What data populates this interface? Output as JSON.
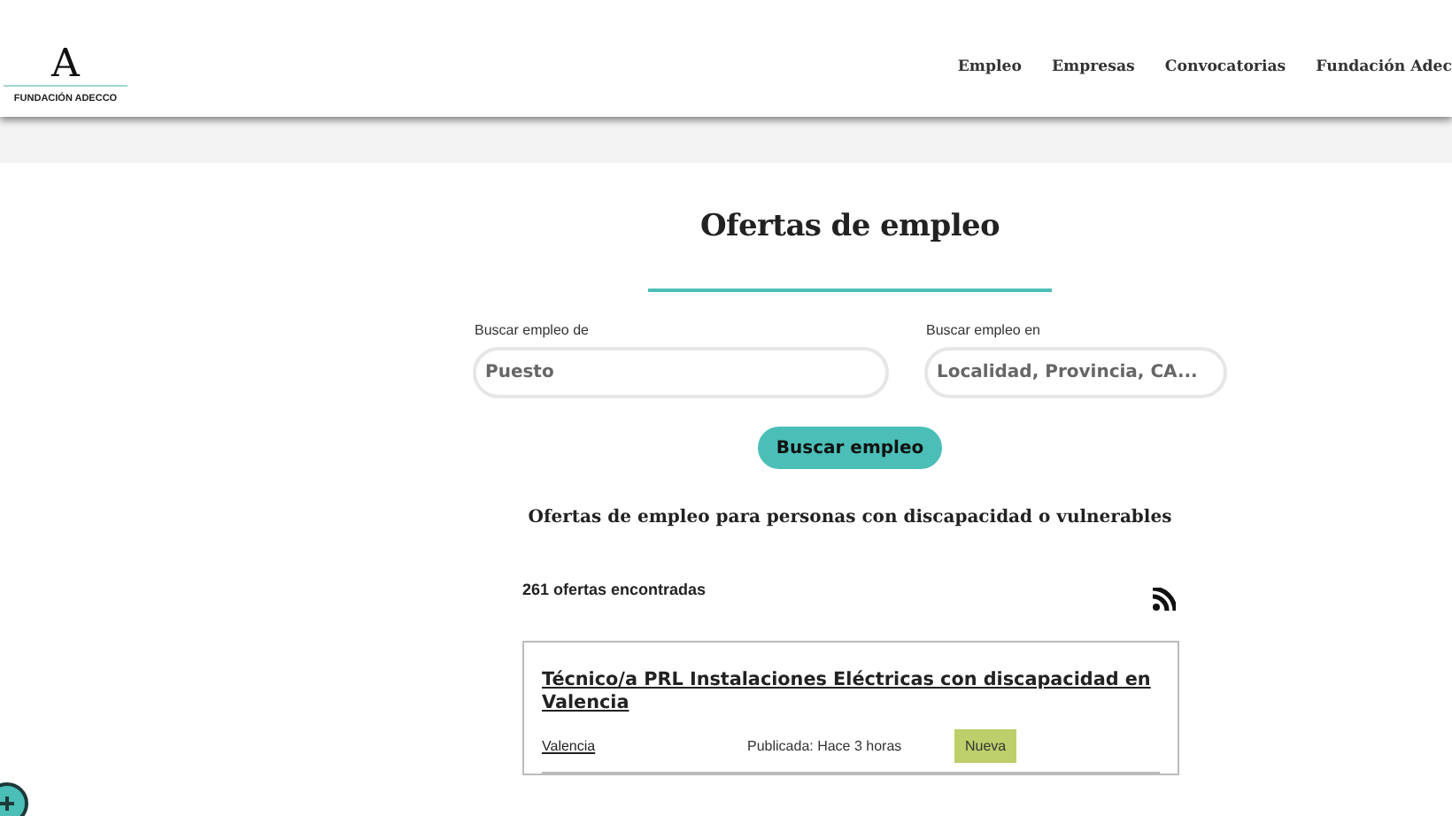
{
  "header": {
    "logo_text": "FUNDACIÓN ADECCO",
    "logo_letter": "A",
    "nav": [
      {
        "label": "Empleo"
      },
      {
        "label": "Empresas"
      },
      {
        "label": "Convocatorias"
      },
      {
        "label": "Fundación Adec"
      }
    ]
  },
  "search": {
    "title": "Ofertas de empleo",
    "fields": [
      {
        "label": "Buscar empleo de",
        "placeholder": "Puesto"
      },
      {
        "label": "Buscar empleo en",
        "placeholder": "Localidad, Provincia, CA..."
      }
    ],
    "button": "Buscar empleo",
    "subtitle": "Ofertas de empleo para personas con discapacidad o vulnerables"
  },
  "results": {
    "count": "261 ofertas encontradas",
    "jobs": [
      {
        "title": "Técnico/a PRL Instalaciones Eléctricas con discapacidad en Valencia",
        "location": "Valencia",
        "published": "Publicada: Hace 3 horas",
        "badge": "Nueva"
      }
    ]
  }
}
